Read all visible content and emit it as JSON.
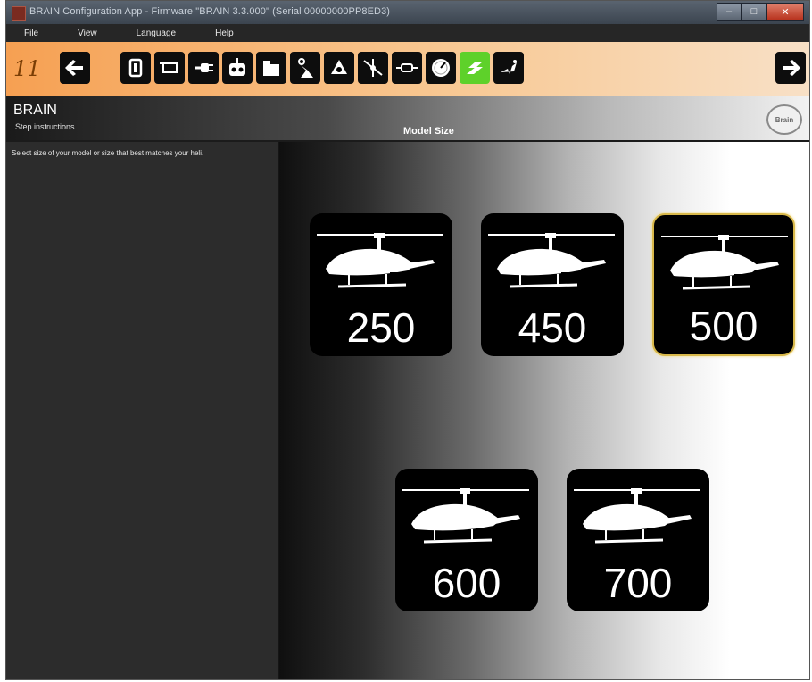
{
  "window": {
    "title": "BRAIN Configuration App - Firmware \"BRAIN 3.3.000\" (Serial 00000000PP8ED3)",
    "controls": [
      "–",
      "□",
      "✕"
    ]
  },
  "menu": [
    "File",
    "View",
    "Language",
    "Help"
  ],
  "toolbar": {
    "step_number": "11",
    "buttons": [
      {
        "name": "back-arrow-icon"
      },
      {
        "name": "receiver-icon"
      },
      {
        "name": "mount-icon"
      },
      {
        "name": "plug-icon"
      },
      {
        "name": "transmitter-icon"
      },
      {
        "name": "box-icon"
      },
      {
        "name": "servo-icon"
      },
      {
        "name": "swashplate-icon"
      },
      {
        "name": "rotor-icon"
      },
      {
        "name": "sensor-icon"
      },
      {
        "name": "gauge-icon"
      },
      {
        "name": "model-size-icon",
        "active": true
      },
      {
        "name": "flight-icon"
      },
      {
        "name": "next-arrow-icon"
      }
    ],
    "active_color": "#5ed12a"
  },
  "header": {
    "brand": "BRAIN",
    "subtitle": "Step instructions",
    "section_title": "Model Size",
    "logo_text": "Brain"
  },
  "instruction": "Select size of your model or size that best matches your heli.",
  "sizes": [
    {
      "label": "250",
      "selected": false
    },
    {
      "label": "450",
      "selected": false
    },
    {
      "label": "500",
      "selected": true
    },
    {
      "label": "600",
      "selected": false
    },
    {
      "label": "700",
      "selected": false
    }
  ],
  "colors": {
    "selected_border": "#d8b84a",
    "toolbar_orange": "#f6a052"
  }
}
